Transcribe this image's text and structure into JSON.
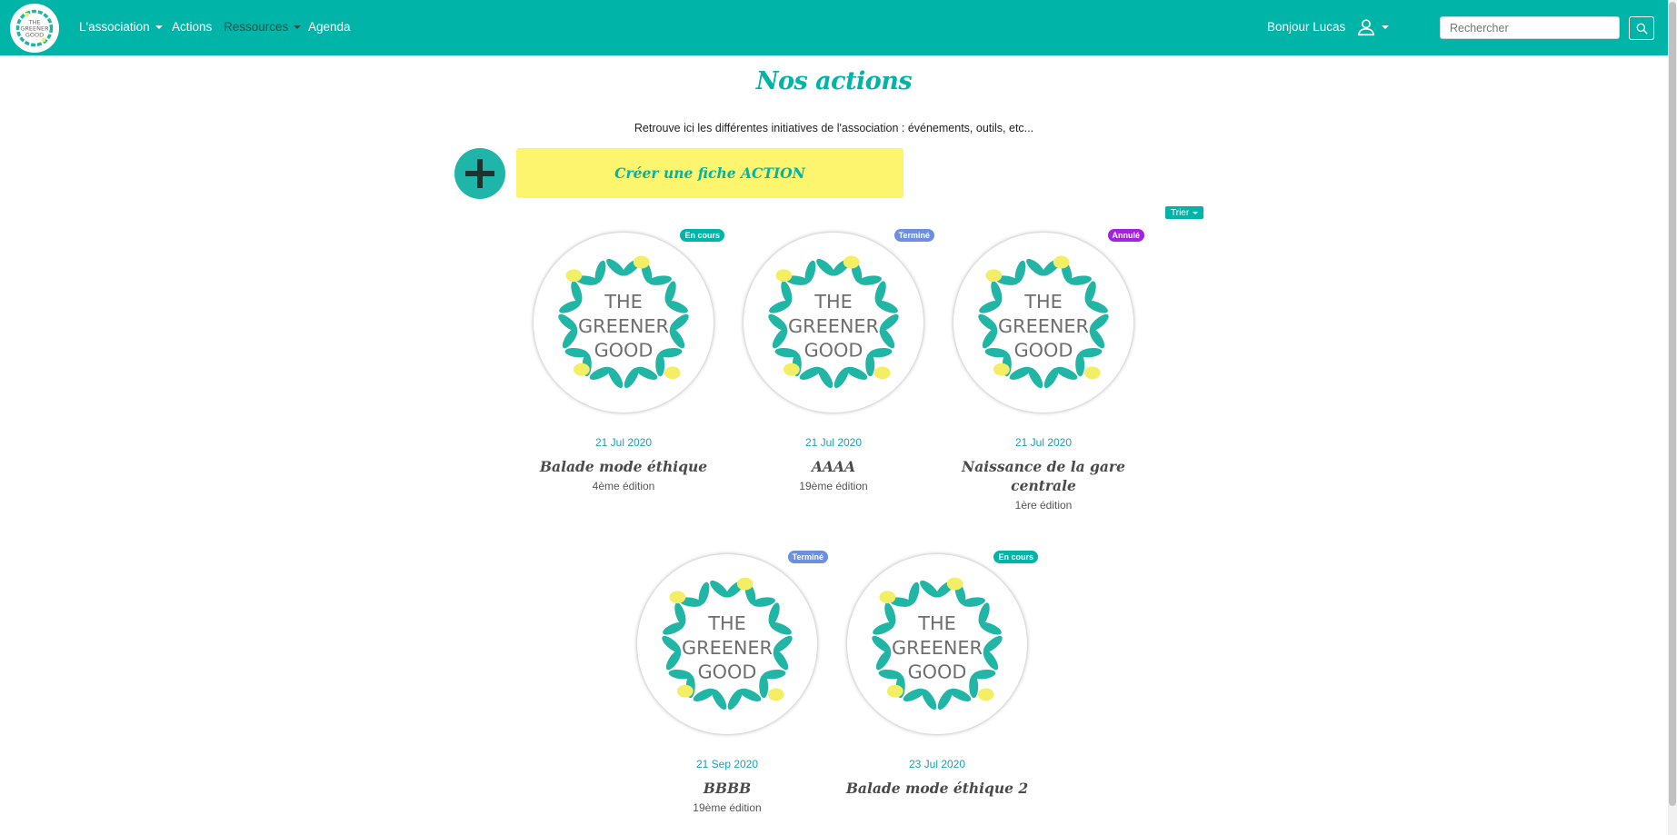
{
  "navbar": {
    "logo_text": [
      "THE",
      "GREENER",
      "GOOD"
    ],
    "links": [
      {
        "label": "L'association",
        "dropdown": true
      },
      {
        "label": "Actions",
        "dropdown": false
      },
      {
        "label": "Ressources",
        "dropdown": true
      },
      {
        "label": "Agenda",
        "dropdown": false
      }
    ],
    "greeting": "Bonjour Lucas",
    "search_placeholder": "Rechercher"
  },
  "main": {
    "title": "Nos actions",
    "intro": "Retrouve ici les différentes initiatives de l'association : événements, outils, etc...",
    "create_label": "Créer une fiche ACTION",
    "sort_label": "Trier",
    "cards": [
      {
        "status": "En cours",
        "status_color": "#00b4a7",
        "date": "21 Jul 2020",
        "name": "Balade mode éthique",
        "edition": "4ème édition"
      },
      {
        "status": "Terminé",
        "status_color": "#6c8fe0",
        "date": "21 Jul 2020",
        "name": "AAAA",
        "edition": "19ème édition"
      },
      {
        "status": "Annulé",
        "status_color": "#a322e0",
        "date": "21 Jul 2020",
        "name": "Naissance de la gare centrale",
        "edition": "1ère édition"
      },
      {
        "status": "Terminé",
        "status_color": "#6c8fe0",
        "date": "21 Sep 2020",
        "name": "BBBB",
        "edition": "19ème édition"
      },
      {
        "status": "En cours",
        "status_color": "#00b4a7",
        "date": "23 Jul 2020",
        "name": "Balade mode éthique 2",
        "edition": ""
      }
    ]
  },
  "colors": {
    "brand": "#00b4a7",
    "accent_yellow": "#fdf56e",
    "leaf": "#21b5a5",
    "lemon": "#f3ee63"
  },
  "icons": {
    "add": "plus-icon",
    "user": "user-icon",
    "search": "search-icon"
  }
}
